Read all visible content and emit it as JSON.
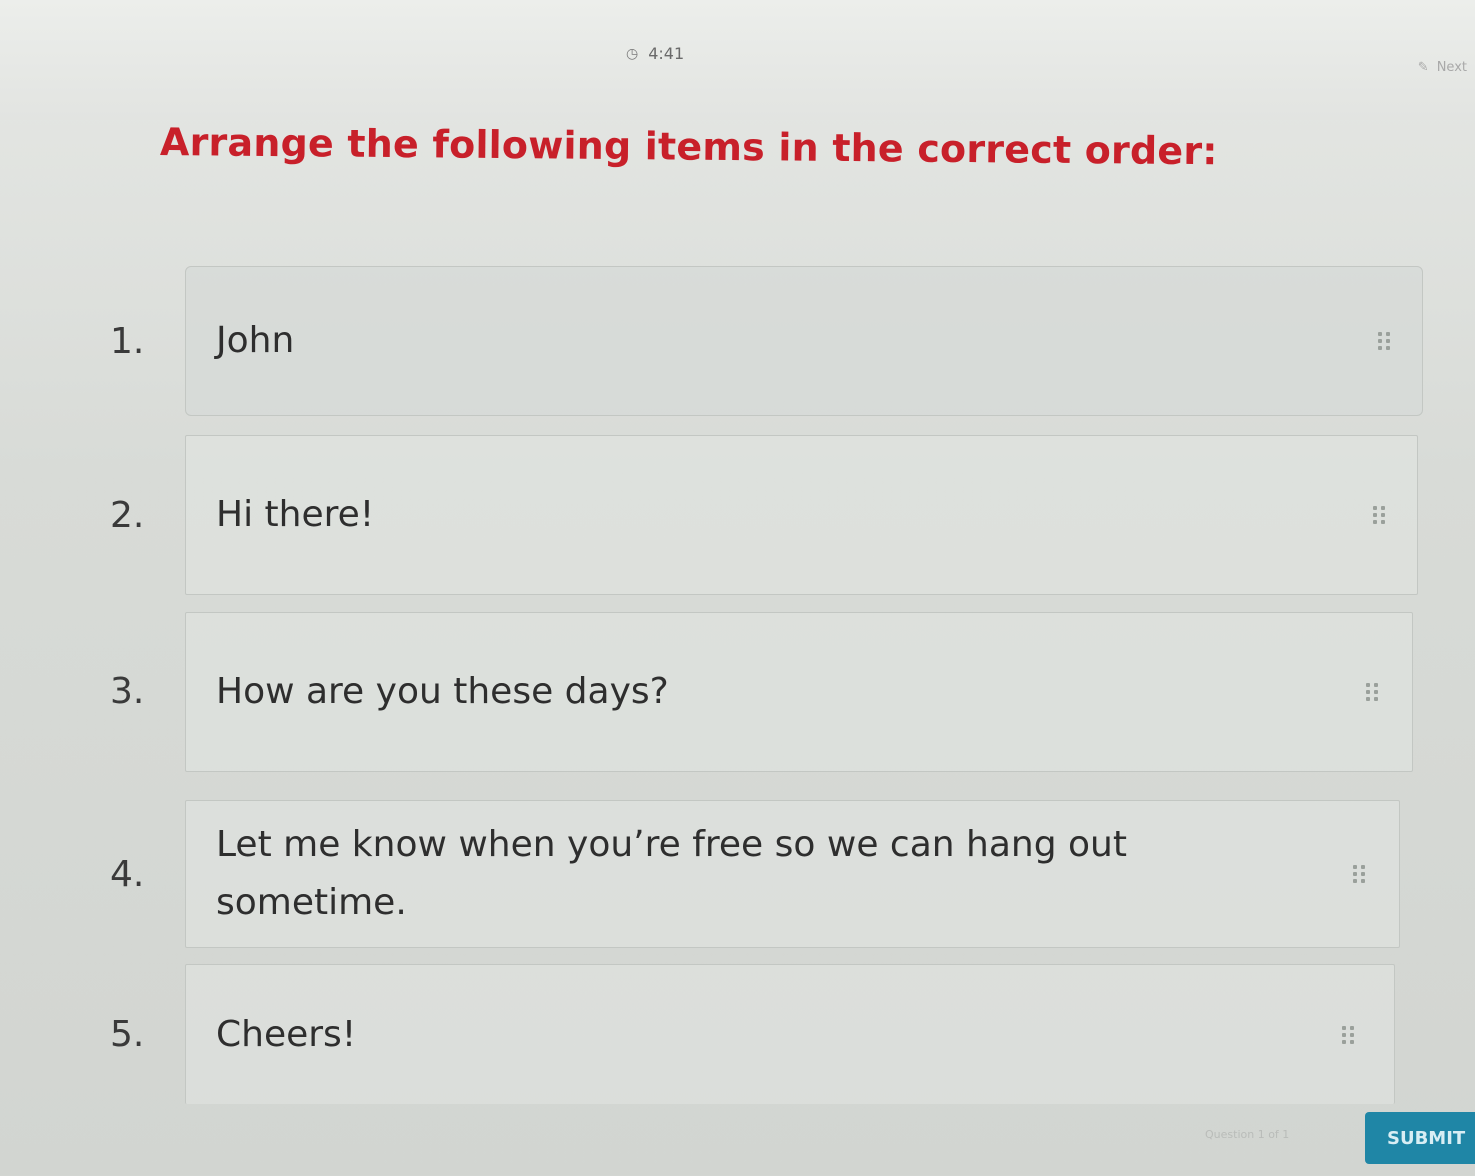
{
  "header": {
    "timer": "4:41",
    "timer_icon": "clock-icon",
    "corner_text": "Next"
  },
  "question": {
    "title": "Arrange the following items in the correct order:"
  },
  "items": [
    {
      "number": "1.",
      "text": "John"
    },
    {
      "number": "2.",
      "text": "Hi there!"
    },
    {
      "number": "3.",
      "text": "How are you these days?"
    },
    {
      "number": "4.",
      "text": "Let me know when you’re free so we can hang out sometime."
    },
    {
      "number": "5.",
      "text": "Cheers!"
    }
  ],
  "footer": {
    "submit_label": "SUBMIT",
    "faint_text": "Question 1 of 1"
  },
  "colors": {
    "title": "#c8202a",
    "submit": "#1f86a6"
  }
}
